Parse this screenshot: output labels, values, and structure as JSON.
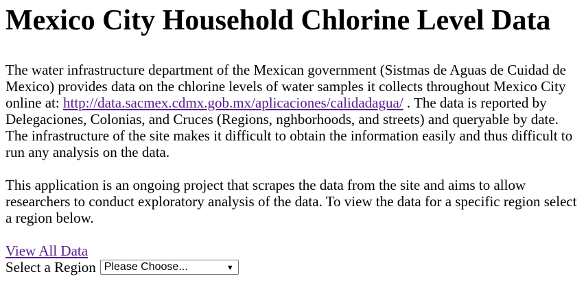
{
  "title": "Mexico City Household Chlorine Level Data",
  "intro": {
    "before_link": "The water infrastructure department of the Mexican government (Sistmas de Aguas de Cuidad de Mexico) provides data on the chlorine levels of water samples it collects throughout Mexico City online at: ",
    "link_text": "http://data.sacmex.cdmx.gob.mx/aplicaciones/calidadagua/",
    "after_link": " . The data is reported by Delegaciones, Colonias, and Cruces (Regions, nghborhoods, and streets) and queryable by date. The infrastructure of the site makes it difficult to obtain the information easily and thus difficult to run any analysis on the data."
  },
  "project": {
    "text": "This application is an ongoing project that scrapes the data from the site and aims to allow researchers to conduct exploratory analysis of the data. To view the data for a specific region select a region below."
  },
  "view_all": {
    "label": "View All Data"
  },
  "region_select": {
    "label": "Select a Region",
    "selected": "Please Choose...",
    "arrow": "▼"
  },
  "colors": {
    "link": "#551a8b",
    "text": "#000000",
    "background": "#ffffff"
  },
  "icons": {
    "dropdown": "chevron-down-icon"
  }
}
